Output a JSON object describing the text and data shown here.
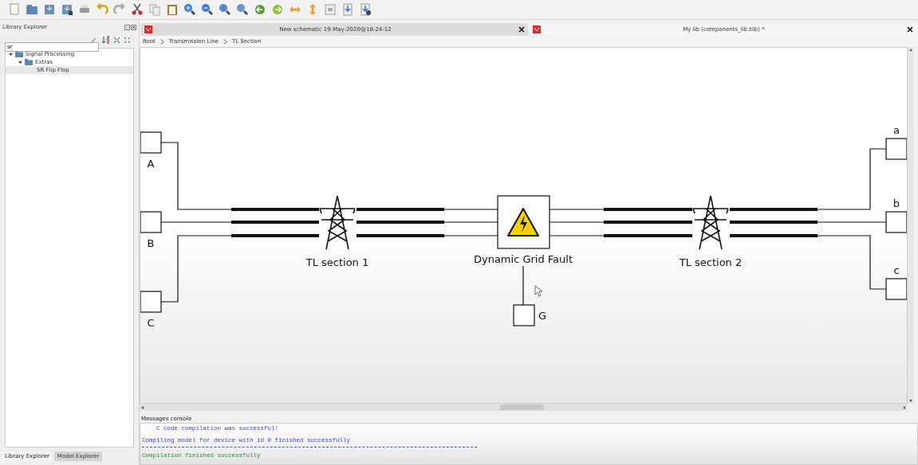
{
  "library_explorer": {
    "title": "Library Explorer",
    "search": {
      "value": "sr"
    },
    "tree": [
      {
        "label": "Signal Processing",
        "expanded": true,
        "selected": false,
        "children": [
          {
            "label": "Extras",
            "expanded": true,
            "selected": false,
            "children": [
              {
                "label": "SR Flip Flop",
                "selected": true
              }
            ]
          }
        ]
      }
    ]
  },
  "tabs": [
    {
      "label": "New schematic 19-May-2020@18-24-12",
      "selected": false
    },
    {
      "label": "My lib (components_lib.tlib) *",
      "selected": true
    }
  ],
  "breadcrumb": [
    "Root",
    "Transmission Line",
    "TL Section"
  ],
  "schematic": {
    "ports": [
      {
        "label": "A"
      },
      {
        "label": "B"
      },
      {
        "label": "C"
      },
      {
        "label": "a"
      },
      {
        "label": "b"
      },
      {
        "label": "c"
      },
      {
        "label": "G"
      }
    ],
    "components": [
      {
        "kind": "tower",
        "label": "TL section 1"
      },
      {
        "kind": "fault",
        "label": "Dynamic Grid Fault"
      },
      {
        "kind": "tower",
        "label": "TL section 2"
      }
    ]
  },
  "messages_console": {
    "title": "Messages console",
    "lines": [
      {
        "kind": "info",
        "text": "C code compilation was successful!"
      },
      {
        "kind": "info",
        "text": "Compiling model for device with id 0 finished successfully"
      },
      {
        "kind": "rule"
      },
      {
        "kind": "success",
        "text": "Compilation finished successfully"
      }
    ]
  },
  "bottom_tabs": [
    {
      "label": "Library Explorer",
      "selected": true
    },
    {
      "label": "Model Explorer",
      "selected": false
    }
  ]
}
